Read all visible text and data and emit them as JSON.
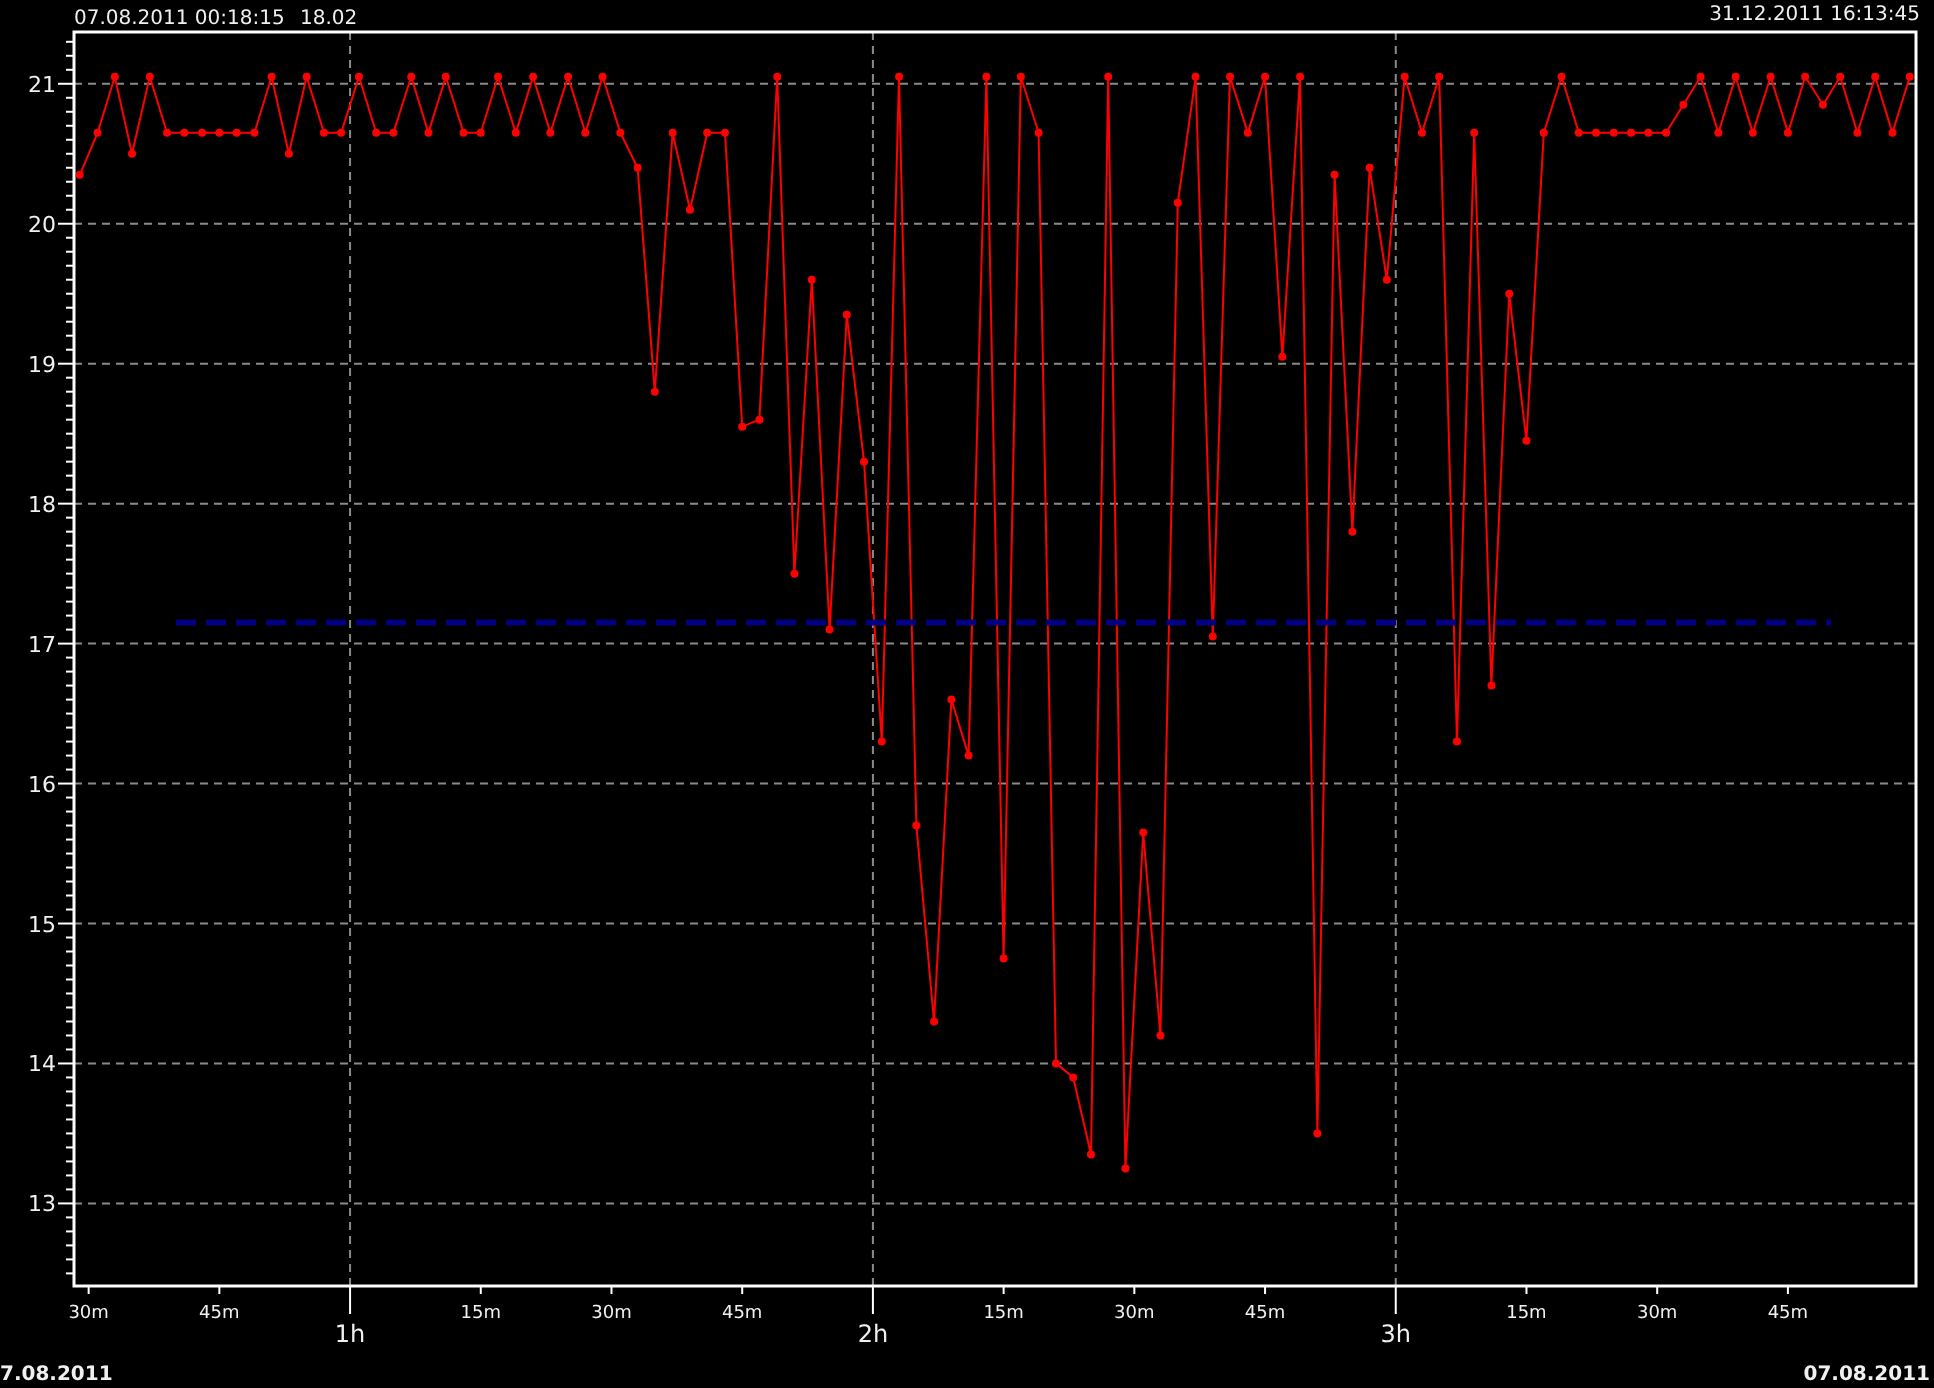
{
  "cursor_readout": {
    "timestamp": "07.08.2011 00:18:15",
    "value": "18.02"
  },
  "range_end": "31.12.2011 16:13:45",
  "chart": {
    "chart_data": {
      "type": "line",
      "grid": true,
      "x": [
        0.483,
        0.517,
        0.55,
        0.583,
        0.617,
        0.65,
        0.683,
        0.717,
        0.75,
        0.783,
        0.817,
        0.85,
        0.883,
        0.917,
        0.95,
        0.983,
        1.017,
        1.05,
        1.083,
        1.117,
        1.15,
        1.183,
        1.217,
        1.25,
        1.283,
        1.317,
        1.35,
        1.383,
        1.417,
        1.45,
        1.483,
        1.517,
        1.55,
        1.583,
        1.617,
        1.65,
        1.683,
        1.717,
        1.75,
        1.783,
        1.817,
        1.85,
        1.883,
        1.917,
        1.95,
        1.983,
        2.017,
        2.05,
        2.083,
        2.117,
        2.15,
        2.183,
        2.217,
        2.25,
        2.283,
        2.317,
        2.35,
        2.383,
        2.417,
        2.45,
        2.483,
        2.517,
        2.55,
        2.583,
        2.617,
        2.65,
        2.683,
        2.717,
        2.75,
        2.783,
        2.817,
        2.85,
        2.883,
        2.917,
        2.95,
        2.983,
        3.017,
        3.05,
        3.083,
        3.117,
        3.15,
        3.183,
        3.217,
        3.25,
        3.283,
        3.317,
        3.35,
        3.383,
        3.417,
        3.45,
        3.483,
        3.517,
        3.55,
        3.583,
        3.617,
        3.65,
        3.683,
        3.717,
        3.75,
        3.783,
        3.817,
        3.85,
        3.883,
        3.917,
        3.95,
        3.983
      ],
      "series": [
        {
          "color": "#ff0000",
          "line_style": "solid",
          "marker": "circle",
          "values": [
            20.35,
            20.65,
            21.05,
            20.5,
            21.05,
            20.65,
            20.65,
            20.65,
            20.65,
            20.65,
            20.65,
            21.05,
            20.5,
            21.05,
            20.65,
            20.65,
            21.05,
            20.65,
            20.65,
            21.05,
            20.65,
            21.05,
            20.65,
            20.65,
            21.05,
            20.65,
            21.05,
            20.65,
            21.05,
            20.65,
            21.05,
            20.65,
            20.4,
            18.8,
            20.65,
            20.1,
            20.65,
            20.65,
            18.55,
            18.6,
            21.05,
            17.5,
            19.6,
            17.1,
            19.35,
            18.3,
            16.3,
            21.05,
            15.7,
            14.3,
            16.6,
            16.2,
            21.05,
            14.75,
            21.05,
            20.65,
            14.0,
            13.9,
            13.35,
            21.05,
            13.25,
            15.65,
            14.2,
            20.15,
            21.05,
            17.05,
            21.05,
            20.65,
            21.05,
            19.05,
            21.05,
            13.5,
            20.35,
            17.8,
            20.4,
            19.6,
            21.05,
            20.65,
            21.05,
            16.3,
            20.65,
            16.7,
            19.5,
            18.45,
            20.65,
            21.05,
            20.65,
            20.65,
            20.65,
            20.65,
            20.65,
            20.65,
            20.85,
            21.05,
            20.65,
            21.05,
            20.65,
            21.05,
            20.65,
            21.05,
            20.85,
            21.05,
            20.65,
            21.05,
            20.65,
            21.05
          ]
        },
        {
          "color": "#000080",
          "line_style": "dashed",
          "x": [
            0.667,
            3.833
          ],
          "values": [
            17.15,
            17.15
          ]
        }
      ],
      "xlim": [
        0.472,
        3.995
      ],
      "ylim": [
        12.41,
        21.37
      ],
      "xticks": [
        {
          "value": 1,
          "label": "1h"
        },
        {
          "value": 2,
          "label": "2h"
        },
        {
          "value": 3,
          "label": "3h"
        }
      ],
      "yticks": [
        13,
        14,
        15,
        16,
        17,
        18,
        19,
        20,
        21
      ]
    },
    "minute_labels": [
      "30m",
      "45m",
      "15m",
      "30m",
      "45m",
      "15m",
      "30m",
      "45m",
      "15m",
      "30m",
      "45m"
    ]
  },
  "range_start_date": "7.08.2011",
  "range_end_date": "07.08.2011"
}
